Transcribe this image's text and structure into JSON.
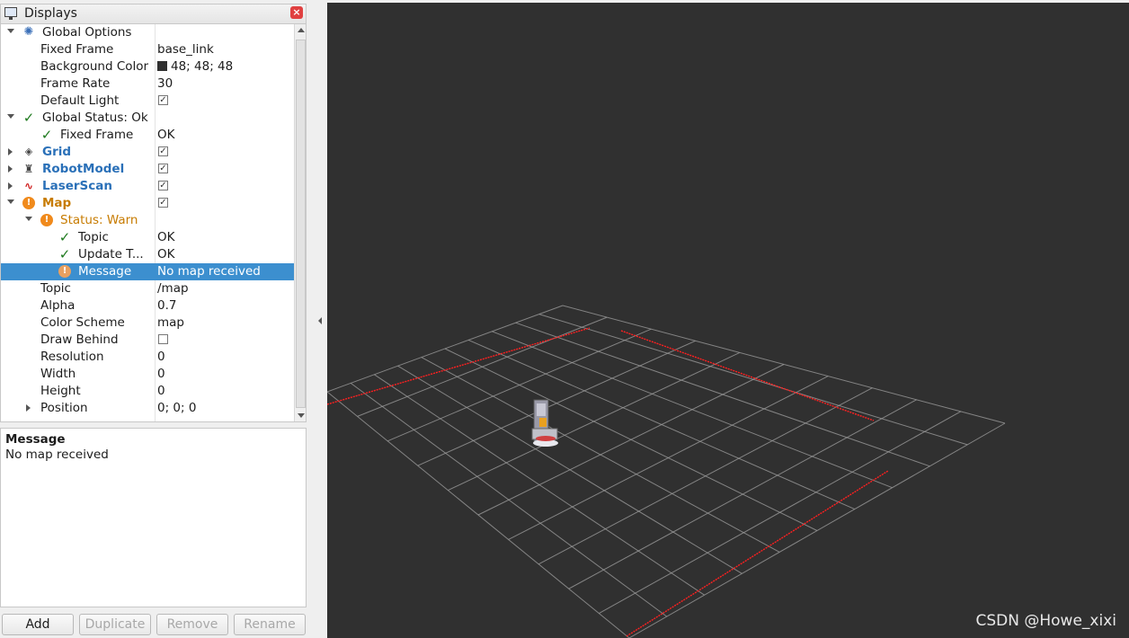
{
  "panel": {
    "title": "Displays"
  },
  "tree": [
    {
      "name": "Global Options",
      "value": ""
    },
    {
      "name": "Fixed Frame",
      "value": "base_link"
    },
    {
      "name": "Background Color",
      "value": "48; 48; 48"
    },
    {
      "name": "Frame Rate",
      "value": "30"
    },
    {
      "name": "Default Light",
      "value": ""
    },
    {
      "name": "Global Status: Ok",
      "value": ""
    },
    {
      "name": "Fixed Frame",
      "value": "OK"
    },
    {
      "name": "Grid",
      "value": ""
    },
    {
      "name": "RobotModel",
      "value": ""
    },
    {
      "name": "LaserScan",
      "value": ""
    },
    {
      "name": "Map",
      "value": ""
    },
    {
      "name": "Status: Warn",
      "value": ""
    },
    {
      "name": "Topic",
      "value": "OK"
    },
    {
      "name": "Update T...",
      "value": "OK"
    },
    {
      "name": "Message",
      "value": "No map received"
    },
    {
      "name": "Topic",
      "value": "/map"
    },
    {
      "name": "Alpha",
      "value": "0.7"
    },
    {
      "name": "Color Scheme",
      "value": "map"
    },
    {
      "name": "Draw Behind",
      "value": ""
    },
    {
      "name": "Resolution",
      "value": "0"
    },
    {
      "name": "Width",
      "value": "0"
    },
    {
      "name": "Height",
      "value": "0"
    },
    {
      "name": "Position",
      "value": "0; 0; 0"
    }
  ],
  "message_box": {
    "title": "Message",
    "body": "No map received"
  },
  "buttons": {
    "add": "Add",
    "duplicate": "Duplicate",
    "remove": "Remove",
    "rename": "Rename"
  },
  "viewport": {
    "background": "#303030",
    "grid_color": "#a0a0a0",
    "laser_color": "#ff2020"
  },
  "watermark": "CSDN @Howe_xixi"
}
